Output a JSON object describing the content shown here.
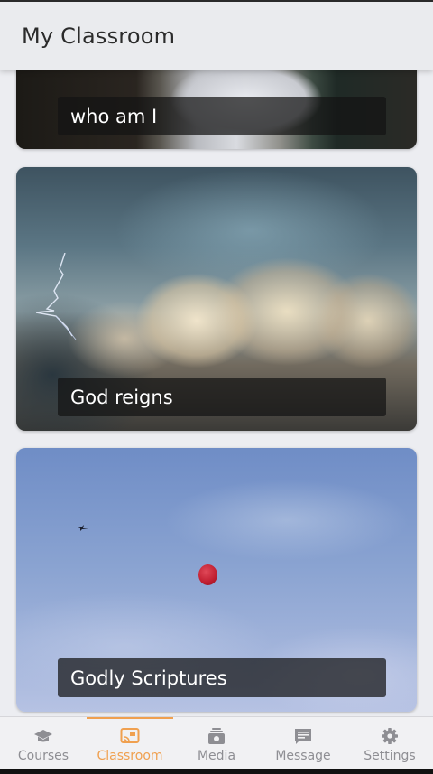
{
  "app_bar": {
    "title": "My Classroom"
  },
  "cards": [
    {
      "title": "who am I"
    },
    {
      "title": "God reigns"
    },
    {
      "title": "Godly Scriptures"
    }
  ],
  "bottom_nav": {
    "items": [
      {
        "label": "Courses",
        "icon": "graduation-cap-icon",
        "active": false
      },
      {
        "label": "Classroom",
        "icon": "cast-board-icon",
        "active": true
      },
      {
        "label": "Media",
        "icon": "media-stack-icon",
        "active": false
      },
      {
        "label": "Message",
        "icon": "message-icon",
        "active": false
      },
      {
        "label": "Settings",
        "icon": "gear-icon",
        "active": false
      }
    ]
  },
  "colors": {
    "accent": "#f0a04f",
    "inactive": "#8e8e93",
    "app_bar": "#eaebee",
    "background": "#ecedf1"
  }
}
